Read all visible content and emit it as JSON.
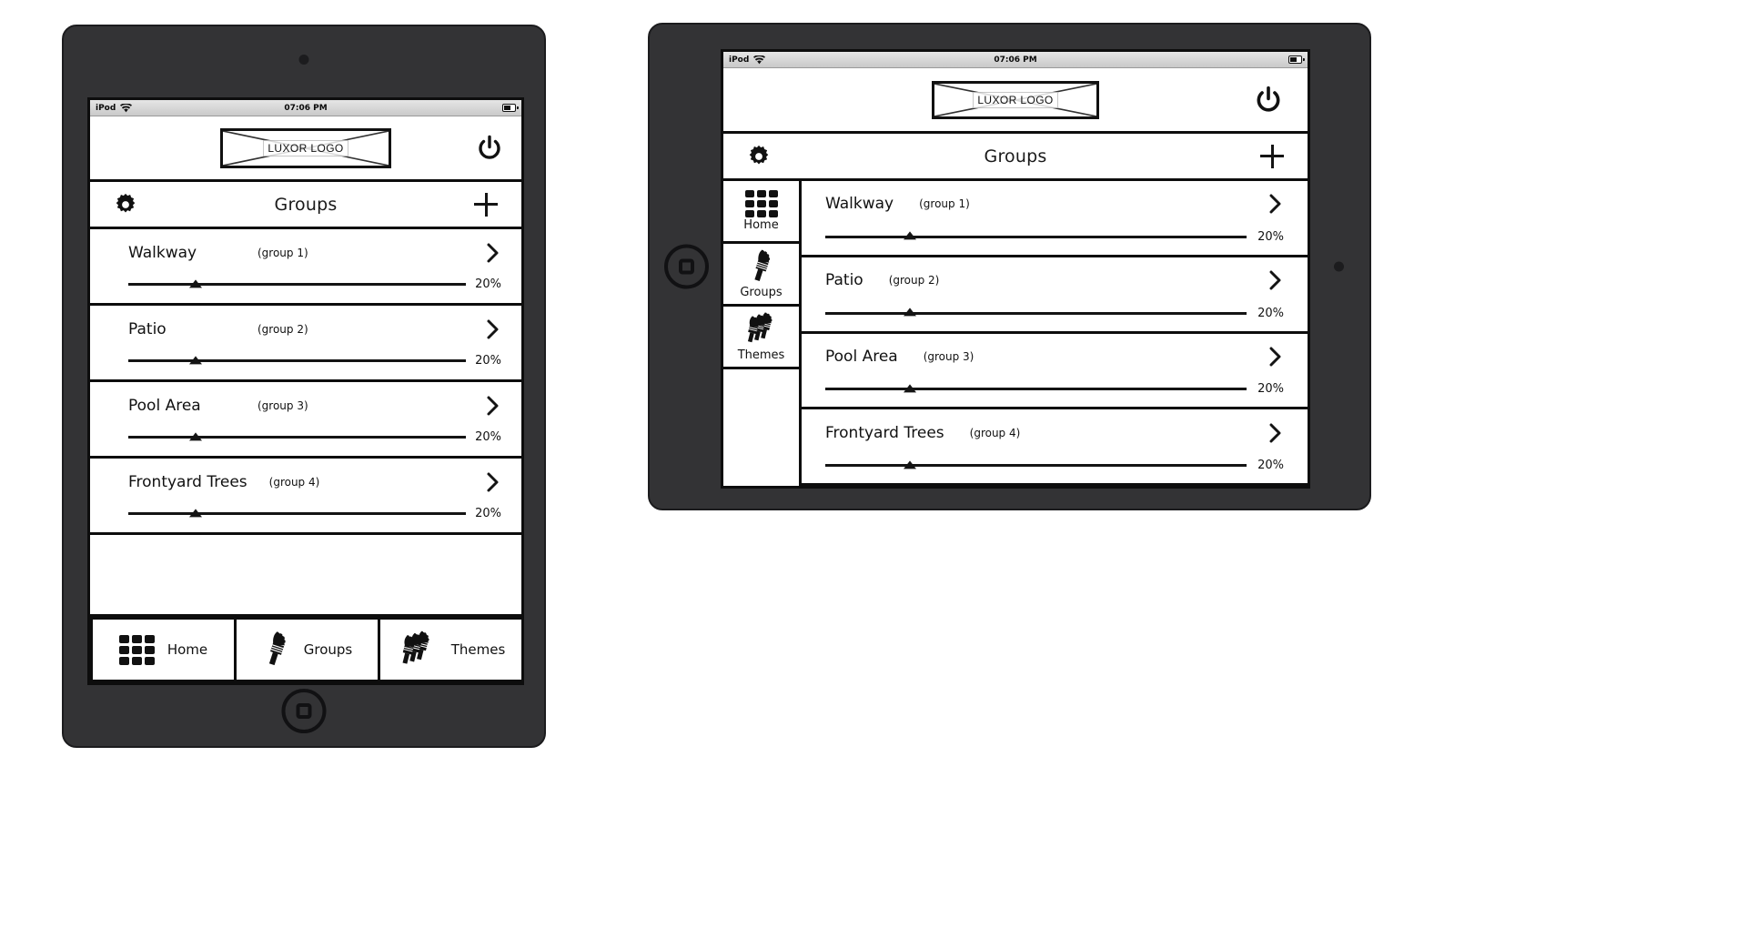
{
  "statusbar": {
    "carrier": "iPod",
    "wifi_icon": "wifi-icon",
    "time": "07:06 PM",
    "battery_icon": "battery-icon"
  },
  "header": {
    "logo_text": "LUXOR LOGO",
    "logo_placeholder_icon": "image-placeholder-cross",
    "power_icon": "power-icon"
  },
  "navbar": {
    "settings_icon": "gear-icon",
    "title": "Groups",
    "add_icon": "plus-icon"
  },
  "groups": [
    {
      "name": "Walkway",
      "group": "(group 1)",
      "level": "20%",
      "level_value": 20,
      "chevron_icon": "chevron-right-icon"
    },
    {
      "name": "Patio",
      "group": "(group 2)",
      "level": "20%",
      "level_value": 20,
      "chevron_icon": "chevron-right-icon"
    },
    {
      "name": "Pool Area",
      "group": "(group 3)",
      "level": "20%",
      "level_value": 20,
      "chevron_icon": "chevron-right-icon"
    },
    {
      "name": "Frontyard Trees",
      "group": "(group 4)",
      "level": "20%",
      "level_value": 20,
      "chevron_icon": "chevron-right-icon"
    }
  ],
  "tabs": [
    {
      "label": "Home",
      "icon": "grid-icon"
    },
    {
      "label": "Groups",
      "icon": "single-light-fixture-icon"
    },
    {
      "label": "Themes",
      "icon": "multiple-light-fixtures-icon"
    }
  ],
  "devices": {
    "phone": {
      "name": "iPod touch",
      "orientation": "portrait",
      "home_button_icon": "home-button-icon",
      "camera_icon": "camera-dot"
    },
    "tablet": {
      "name": "iPad",
      "orientation": "landscape",
      "home_button_icon": "home-button-icon",
      "camera_icon": "camera-dot"
    }
  },
  "colors": {
    "bezel": "#333335",
    "outline": "#0d0d0d",
    "screen": "#ffffff",
    "ink": "#111111",
    "statusbar": "#d8d8d8"
  }
}
